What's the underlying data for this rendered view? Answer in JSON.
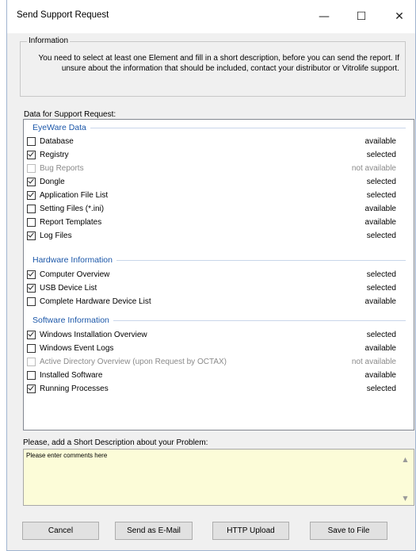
{
  "window": {
    "title": "Send Support Request",
    "minimize": "—",
    "maximize": "☐",
    "close": "✕"
  },
  "info": {
    "legend": "Information",
    "text": "You need to select at least one Element and fill in a short description, before you can send the report. If unsure about the information that should be included, contact your distributor or Vitrolife support."
  },
  "data_label": "Data for Support Request:",
  "sections": {
    "eyeware": {
      "title": "EyeWare Data",
      "rows": [
        {
          "label": "Database",
          "status": "available",
          "checked": false,
          "enabled": true
        },
        {
          "label": "Registry",
          "status": "selected",
          "checked": true,
          "enabled": true
        },
        {
          "label": "Bug Reports",
          "status": "not available",
          "checked": false,
          "enabled": false
        },
        {
          "label": "Dongle",
          "status": "selected",
          "checked": true,
          "enabled": true
        },
        {
          "label": "Application File List",
          "status": "selected",
          "checked": true,
          "enabled": true
        },
        {
          "label": "Setting Files (*.ini)",
          "status": "available",
          "checked": false,
          "enabled": true
        },
        {
          "label": "Report Templates",
          "status": "available",
          "checked": false,
          "enabled": true
        },
        {
          "label": "Log Files",
          "status": "selected",
          "checked": true,
          "enabled": true
        }
      ]
    },
    "hardware": {
      "title": "Hardware Information",
      "rows": [
        {
          "label": "Computer Overview",
          "status": "selected",
          "checked": true,
          "enabled": true
        },
        {
          "label": "USB Device List",
          "status": "selected",
          "checked": true,
          "enabled": true
        },
        {
          "label": "Complete Hardware Device List",
          "status": "available",
          "checked": false,
          "enabled": true
        }
      ]
    },
    "software": {
      "title": "Software Information",
      "rows": [
        {
          "label": "Windows Installation Overview",
          "status": "selected",
          "checked": true,
          "enabled": true
        },
        {
          "label": "Windows Event Logs",
          "status": "available",
          "checked": false,
          "enabled": true
        },
        {
          "label": "Active Directory Overview (upon Request by OCTAX)",
          "status": "not available",
          "checked": false,
          "enabled": false
        },
        {
          "label": "Installed Software",
          "status": "available",
          "checked": false,
          "enabled": true
        },
        {
          "label": "Running Processes",
          "status": "selected",
          "checked": true,
          "enabled": true
        }
      ]
    }
  },
  "description": {
    "label": "Please, add a Short Description about your Problem:",
    "placeholder": "Please enter comments here"
  },
  "buttons": {
    "cancel": "Cancel",
    "send_mail": "Send as E-Mail",
    "http_upload": "HTTP Upload",
    "save_file": "Save to File"
  },
  "colors": {
    "section_title": "#1a56a8",
    "description_bg": "#fcfcd8",
    "disabled_text": "#8a8a8a"
  }
}
